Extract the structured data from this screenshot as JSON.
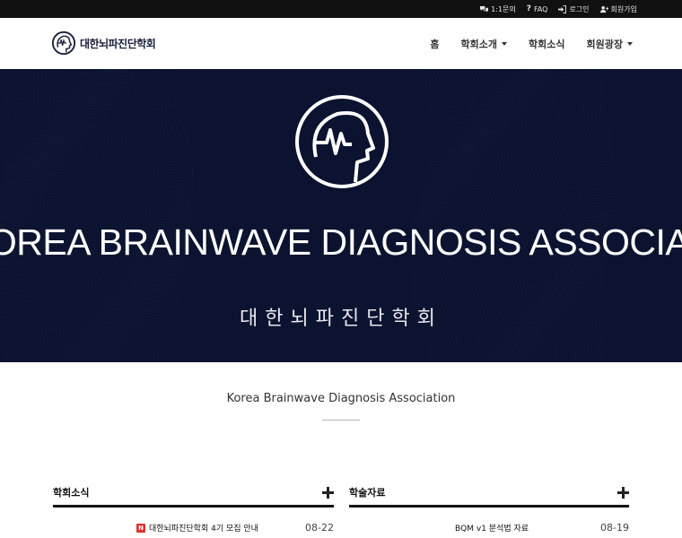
{
  "topbar": {
    "inquiry_label": "1:1문의",
    "faq_label": "FAQ",
    "login_label": "로그인",
    "signup_label": "회원가입"
  },
  "header": {
    "logo_text": "대한뇌파진단학회",
    "nav": [
      {
        "label": "홈",
        "has_dropdown": false
      },
      {
        "label": "학회소개",
        "has_dropdown": true
      },
      {
        "label": "학회소식",
        "has_dropdown": false
      },
      {
        "label": "회원광장",
        "has_dropdown": true
      }
    ]
  },
  "hero": {
    "title": "KOREA BRAINWAVE DIAGNOSIS ASSOCIATION",
    "subtitle": "대한뇌파진단학회"
  },
  "intro": {
    "title": "Korea Brainwave Diagnosis Association"
  },
  "boards": {
    "news": {
      "title": "학회소식",
      "rows": [
        {
          "badge": "N",
          "title": "대한뇌파진단학회 4기 모집 안내",
          "date": "08-22"
        }
      ]
    },
    "materials": {
      "title": "학술자료",
      "rows": [
        {
          "title": "BQM v1 분석법 자료",
          "date": "08-19"
        }
      ]
    }
  },
  "colors": {
    "topbar_bg": "#111111",
    "hero_bg": "#0c1330",
    "badge_red": "#d9342b",
    "logo_navy": "#1a1f3a"
  }
}
